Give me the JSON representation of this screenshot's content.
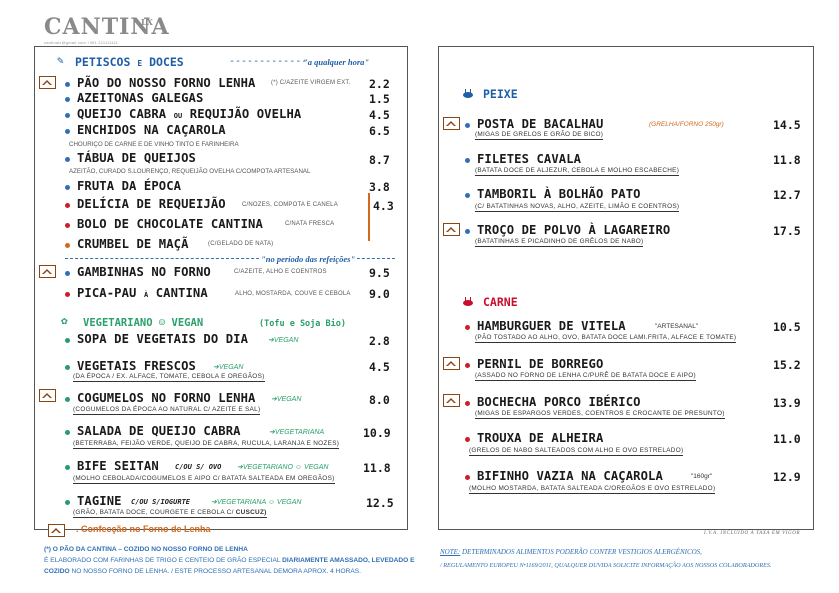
{
  "logo": {
    "word": "CANTINA",
    "sup": "LX",
    "sub": "cantinalx@gmail.com   +351 211111111"
  },
  "left": {
    "petiscos": {
      "title": "PETISCOS",
      "title_join": "E",
      "title2": "DOCES",
      "dashes": "-------------",
      "note": "\"a qualquer hora\""
    },
    "items": [
      {
        "name": "PÃO DO NOSSO FORNO LENHA",
        "desc": "(*) C/AZEITE VIRGEM EXT.",
        "price": "2.2"
      },
      {
        "name": "AZEITONAS GALEGAS",
        "desc": "",
        "price": "1.5"
      },
      {
        "name": "QUEIJO CABRA",
        "join": "OU",
        "name2": "REQUIJÃO OVELHA",
        "price": "4.5"
      },
      {
        "name": "ENCHIDOS NA CAÇAROLA",
        "desc": "CHOURIÇO DE CARNE E DE VINHO TINTO E FARINHEIRA",
        "price": "6.5"
      },
      {
        "name": "TÁBUA DE QUEIJOS",
        "desc": "AZEITÃO, CURADO S.LOURENÇO, REQUEIJÃO OVELHA C/COMPOTA ARTESANAL",
        "price": "8.7"
      },
      {
        "name": "FRUTA DA ÉPOCA",
        "desc": "",
        "price": "3.8"
      },
      {
        "name": "DELÍCIA DE REQUEIJÃO",
        "desc": "C/NOZES, COMPOTA E CANELA",
        "price": "4.3"
      },
      {
        "name": "BOLO DE CHOCOLATE CANTINA",
        "desc": "C/NATA FRESCA",
        "price": ""
      },
      {
        "name": "CRUMBEL DE MAÇÃ",
        "desc": "(C/GELADO DE NATA)",
        "price": ""
      }
    ],
    "refeicoes_note": "\"no período das refeições\"",
    "items2": [
      {
        "name": "GAMBINHAS NO FORNO",
        "desc": "C/AZEITE, ALHO E COENTROS",
        "price": "9.5"
      },
      {
        "name": "PICA-PAU",
        "join": "À",
        "name2": "CANTINA",
        "desc": "ALHO, MOSTARDA, COUVE E CEBOLA",
        "price": "9.0"
      }
    ],
    "veg": {
      "title": "VEGETARIANO",
      "smile": "☺",
      "title2": "VEGAN",
      "note": "(Tofu e Soja Bio)"
    },
    "veg_items": [
      {
        "name": "SOPA DE VEGETAIS DO DIA",
        "tag": "➔VEGAN",
        "desc": "",
        "price": "2.8"
      },
      {
        "name": "VEGETAIS FRESCOS",
        "tag": "➔VEGAN",
        "desc": "(DA ÉPOCA / EX. ALFACE, TOMATE, CEBOLA E OREGÃOS)",
        "price": "4.5"
      },
      {
        "name": "COGUMELOS NO FORNO LENHA",
        "tag": "➔VEGAN",
        "desc": "(COGUMELOS DA ÉPOCA AO NATURAL C/ AZEITE E SAL)",
        "price": "8.0"
      },
      {
        "name": "SALADA DE QUEIJO CABRA",
        "tag": "➔VEGETARIANA",
        "desc": "(BETERRABA, FEIJÃO VERDE, QUEIJO DE CABRA, RUCULA, LARANJA E NOZES)",
        "price": "10.9"
      },
      {
        "name": "BIFE SEITAN",
        "join": "C/OU S/ OVO",
        "tag": "➔VEGETARIANO ☺ VEGAN",
        "desc": "(MOLHO CEBOLADA/COGUMELOS E AIPO C/ BATATA SALTEADA EM OREGÃOS)",
        "price": "11.8"
      },
      {
        "name": "TAGINE",
        "join": "C/OU S/IOGURTE",
        "tag": "➔VEGETARIANA ☺ VEGAN",
        "desc": "(GRÃO, BATATA DOCE, COURGETE E CEBOLA C/",
        "desc2": "CUSCUZ)",
        "price": "12.5"
      }
    ]
  },
  "legend": {
    "text": ". Confecção no Forno de Lenha"
  },
  "footer_left": {
    "line1a": "(*) O PÃO DA CANTINA  –  COZIDO NO NOSSO FORNO DE LENHA",
    "line2": "É ELABORADO COM FARINHAS DE TRIGO E CENTEIO DE GRÃO ESPECIAL",
    "line2b": "DIARIAMENTE AMASSADO, LEVEDADO E",
    "line3a": "COZIDO",
    "line3b": "NO NOSSO FORNO DE LENHA. / ESTE PROCESSO ARTESANAL DEMORA APROX. 4 HORAS."
  },
  "right": {
    "peixe": {
      "title": "PEIXE"
    },
    "peixe_items": [
      {
        "name": "POSTA DE BACALHAU",
        "tag": "(GRELHA/FORNO 250gr)",
        "desc": "(MIGAS DE GRELOS E GRÃO DE BICO)",
        "price": "14.5"
      },
      {
        "name": "FILETES CAVALA",
        "desc": "(BATATA DOCE DE ALJEZUR, CEBOLA E MOLHO ESCABECHE)",
        "price": "11.8"
      },
      {
        "name": "TAMBORIL À BOLHÃO PATO",
        "desc": "(C/ BATATINHAS NOVAS, ALHO, AZEITE, LIMÃO E COENTROS)",
        "price": "12.7"
      },
      {
        "name": "TROÇO DE POLVO À LAGAREIRO",
        "desc": "(BATATINHAS E PICADINHO DE GRÊLOS DE NABO)",
        "price": "17.5"
      }
    ],
    "carne": {
      "title": "CARNE"
    },
    "carne_items": [
      {
        "name": "HAMBURGUER DE VITELA",
        "tag": "\"ARTESANAL\"",
        "desc": "(PÃO TOSTADO AO ALHO, OVO, BATATA DOCE LAMI.FRITA, ALFACE E TOMATE)",
        "price": "10.5"
      },
      {
        "name": "PERNIL DE BORREGO",
        "desc": "(ASSADO NO FORNO DE LENHA C/PURÊ DE BATATA DOCE E AIPO)",
        "price": "15.2"
      },
      {
        "name": "BOCHECHA PORCO IBÉRICO",
        "desc": "(MIGAS DE ESPARGOS VERDES, COENTROS E CROCANTE DE PRESUNTO)",
        "price": "13.9"
      },
      {
        "name": "TROUXA DE ALHEIRA",
        "desc": "(GRELOS DE NABO SALTEADOS COM ALHO E OVO ESTRELADO)",
        "price": "11.0"
      },
      {
        "name": "BIFINHO VAZIA NA CAÇAROLA",
        "tag": "\"160gr\"",
        "desc": "(MOLHO MOSTARDA, BATATA SALTEADA C/OREGÃOS E OVO ESTRELADO)",
        "price": "12.9"
      }
    ],
    "iva": "I.V.A. INCLUIDO À TAXA EM VIGOR"
  },
  "footer_right": {
    "note_label": "NOTE:",
    "note_text": " DETERMINADOS ALIMENTOS PODERÃO CONTER VESTIGIOS ALERGÉNICOS,",
    "line2": "/ REGULAMENTO EUROPEU N•1169/2011, QUALQUER DUVIDA SOLICITE INFORMAÇÃO AOS NOSSOS COLABORADORES."
  },
  "colors": {
    "blue": "#1e5ea8",
    "red": "#c8102e",
    "green": "#2aa06a",
    "oven": "#8b4513",
    "accent_orange": "#d2691e"
  }
}
